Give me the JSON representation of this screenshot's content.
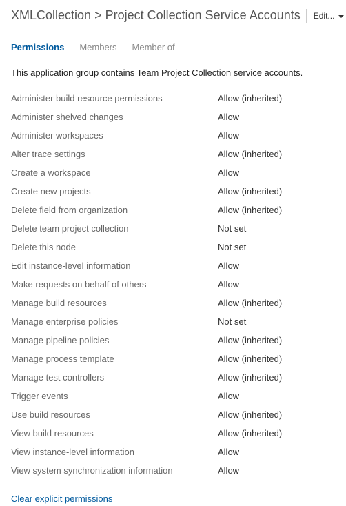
{
  "header": {
    "breadcrumb_collection": "XMLCollection",
    "breadcrumb_sep": ">",
    "breadcrumb_group": "Project Collection Service Accounts",
    "edit_label": "Edit..."
  },
  "tabs": {
    "permissions": "Permissions",
    "members": "Members",
    "member_of": "Member of"
  },
  "description": "This application group contains Team Project Collection service accounts.",
  "permissions": [
    {
      "label": "Administer build resource permissions",
      "value": "Allow (inherited)"
    },
    {
      "label": "Administer shelved changes",
      "value": "Allow"
    },
    {
      "label": "Administer workspaces",
      "value": "Allow"
    },
    {
      "label": "Alter trace settings",
      "value": "Allow (inherited)"
    },
    {
      "label": "Create a workspace",
      "value": "Allow"
    },
    {
      "label": "Create new projects",
      "value": "Allow (inherited)"
    },
    {
      "label": "Delete field from organization",
      "value": "Allow (inherited)"
    },
    {
      "label": "Delete team project collection",
      "value": "Not set"
    },
    {
      "label": "Delete this node",
      "value": "Not set"
    },
    {
      "label": "Edit instance-level information",
      "value": "Allow"
    },
    {
      "label": "Make requests on behalf of others",
      "value": "Allow"
    },
    {
      "label": "Manage build resources",
      "value": "Allow (inherited)"
    },
    {
      "label": "Manage enterprise policies",
      "value": "Not set"
    },
    {
      "label": "Manage pipeline policies",
      "value": "Allow (inherited)"
    },
    {
      "label": "Manage process template",
      "value": "Allow (inherited)"
    },
    {
      "label": "Manage test controllers",
      "value": "Allow (inherited)"
    },
    {
      "label": "Trigger events",
      "value": "Allow"
    },
    {
      "label": "Use build resources",
      "value": "Allow (inherited)"
    },
    {
      "label": "View build resources",
      "value": "Allow (inherited)"
    },
    {
      "label": "View instance-level information",
      "value": "Allow"
    },
    {
      "label": "View system synchronization information",
      "value": "Allow"
    }
  ],
  "actions": {
    "clear_explicit": "Clear explicit permissions"
  }
}
